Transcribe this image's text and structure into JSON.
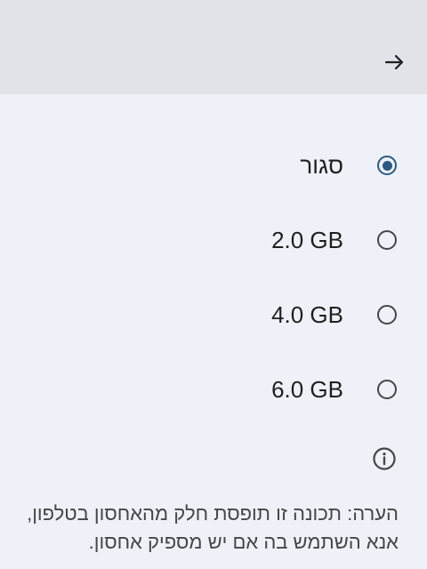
{
  "toolbar": {
    "back_icon": "arrow-icon"
  },
  "options": [
    {
      "label": "סגור",
      "selected": true
    },
    {
      "label": "2.0 GB",
      "selected": false
    },
    {
      "label": "4.0 GB",
      "selected": false
    },
    {
      "label": "6.0 GB",
      "selected": false
    }
  ],
  "info": {
    "icon": "info-icon",
    "note": "הערה: תכונה זו תופסת חלק מהאחסון בטלפון, אנא השתמש בה אם יש מספיק אחסון."
  },
  "colors": {
    "accent": "#2C5A82",
    "toolbar_bg": "#E1E3E8",
    "page_bg": "#EEF1F7"
  }
}
